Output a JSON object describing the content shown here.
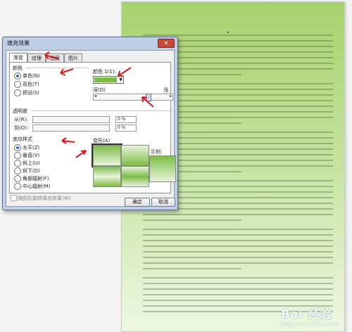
{
  "dialog": {
    "title": "填充效果",
    "close_label": "✕",
    "tabs": [
      "渐变",
      "纹理",
      "图案",
      "图片"
    ],
    "active_tab": "渐变",
    "colors": {
      "group_label": "颜色",
      "options": [
        {
          "label": "单色(N)",
          "selected": true
        },
        {
          "label": "双色(T)",
          "selected": false
        },
        {
          "label": "预设(S)",
          "selected": false
        }
      ],
      "color1_label": "颜色 1(1):",
      "color1_value": "#7cbd48",
      "dark_label": "深(D)",
      "light_label": "浅"
    },
    "transparency": {
      "group_label": "透明度",
      "from_label": "从(R):",
      "to_label": "到(O):",
      "from_value": "0 %",
      "to_value": "0 %"
    },
    "shading": {
      "group_label": "底纹样式",
      "options": [
        {
          "label": "水平(Z)",
          "selected": true
        },
        {
          "label": "垂直(V)",
          "selected": false
        },
        {
          "label": "斜上(U)",
          "selected": false
        },
        {
          "label": "斜下(D)",
          "selected": false
        },
        {
          "label": "角部辐射(F)",
          "selected": false
        },
        {
          "label": "中心辐射(M)",
          "selected": false
        }
      ],
      "variants_label": "变形(A)",
      "sample_label": "示例:"
    },
    "rotate_checkbox_label": "随图形旋转填充效果(W)",
    "ok_label": "确定",
    "cancel_label": "取消"
  },
  "watermark": {
    "text": "Bai  经验",
    "sub": "jingyan.baidu.com"
  },
  "colors": {
    "accent_green": "#7cbd48",
    "arrow_red": "#d7191c"
  }
}
